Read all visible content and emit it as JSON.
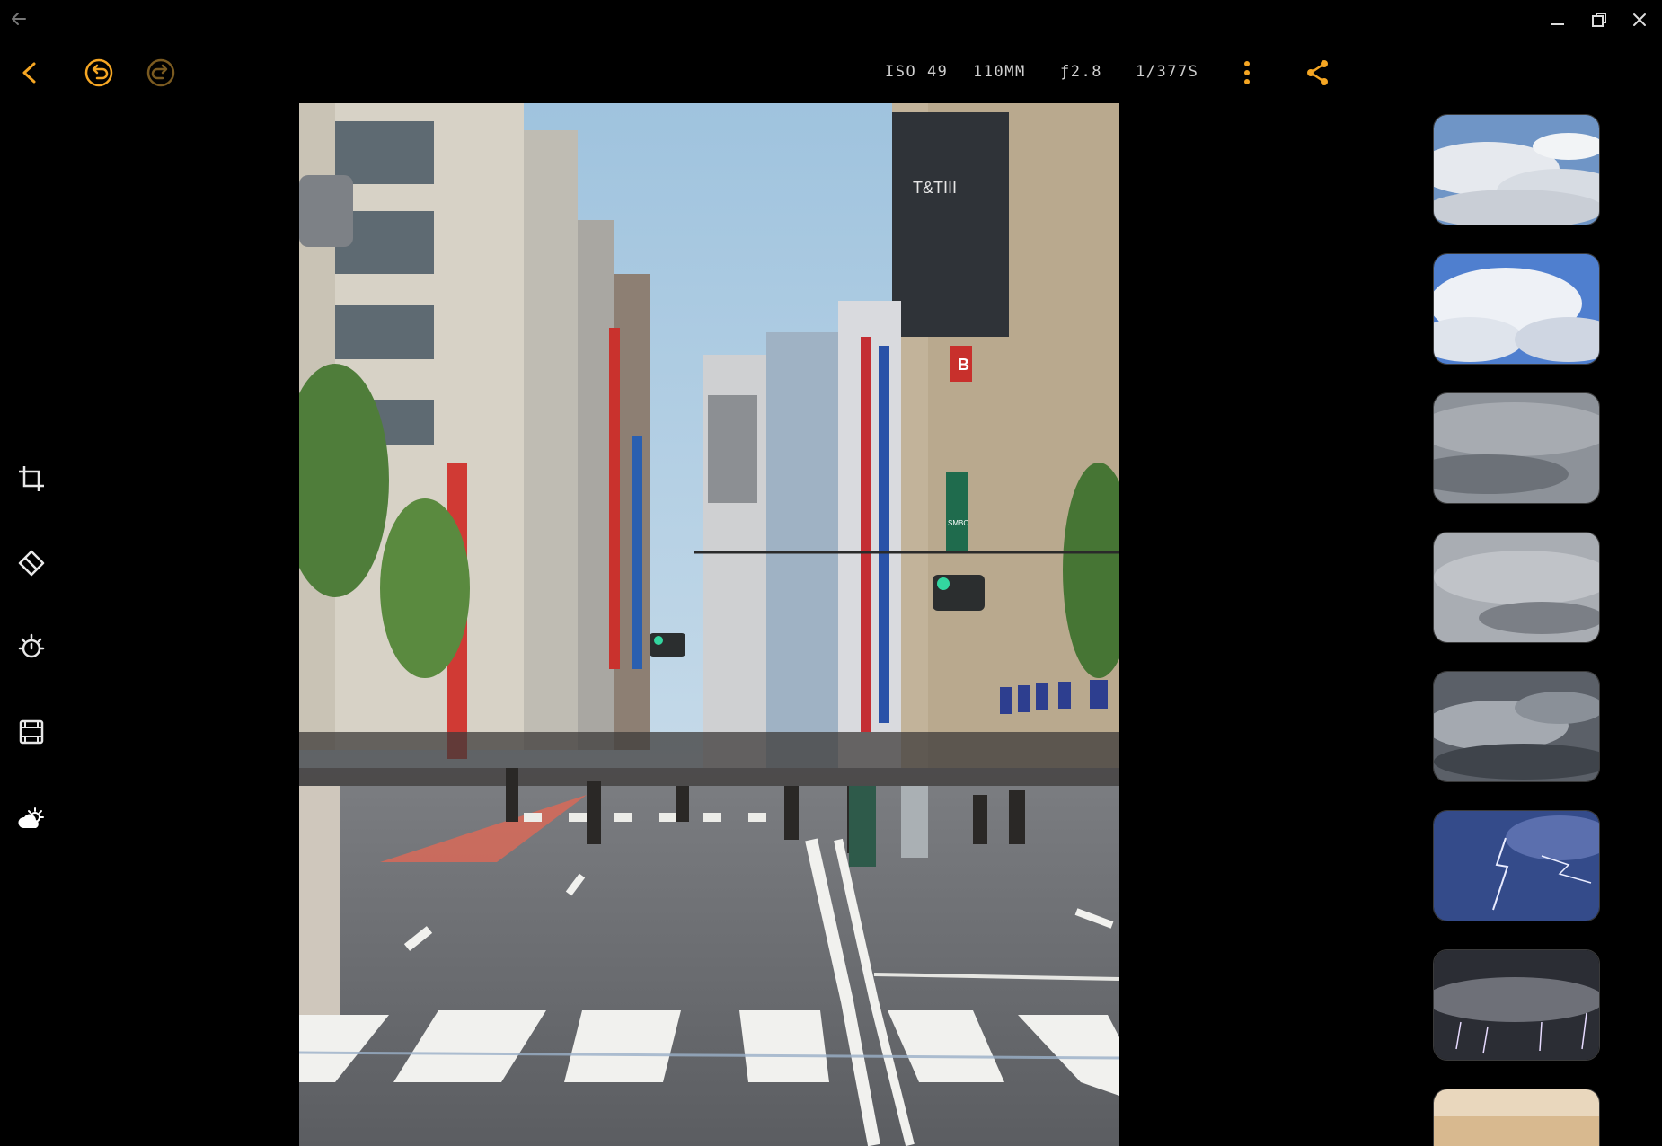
{
  "window": {
    "back_icon": "arrow-left-icon",
    "controls": [
      "minimize-icon",
      "restore-icon",
      "close-icon"
    ]
  },
  "toolbar": {
    "back_icon": "chevron-left-icon",
    "undo_icon": "undo-icon",
    "redo_icon": "redo-icon",
    "more_icon": "more-vertical-icon",
    "share_icon": "share-icon",
    "accent": "#F5A623"
  },
  "exif": {
    "iso": "ISO 49",
    "focal": "110MM",
    "aperture": "ƒ2.8",
    "shutter": "1/377S"
  },
  "tools": [
    "crop-icon",
    "eraser-icon",
    "adjust-icon",
    "film-filter-icon",
    "sky-weather-icon"
  ],
  "photo": {
    "signs": {
      "tt": "T&TIII",
      "b": "B",
      "smbc": "SMBC"
    }
  },
  "sky_presets": [
    "partly-cloudy-sky",
    "cumulus-blue-sky",
    "overcast-gray-sky",
    "light-overcast-sky",
    "dark-storm-clouds",
    "lightning-blue-sky",
    "lightning-night-sky",
    "sunset-sky"
  ]
}
